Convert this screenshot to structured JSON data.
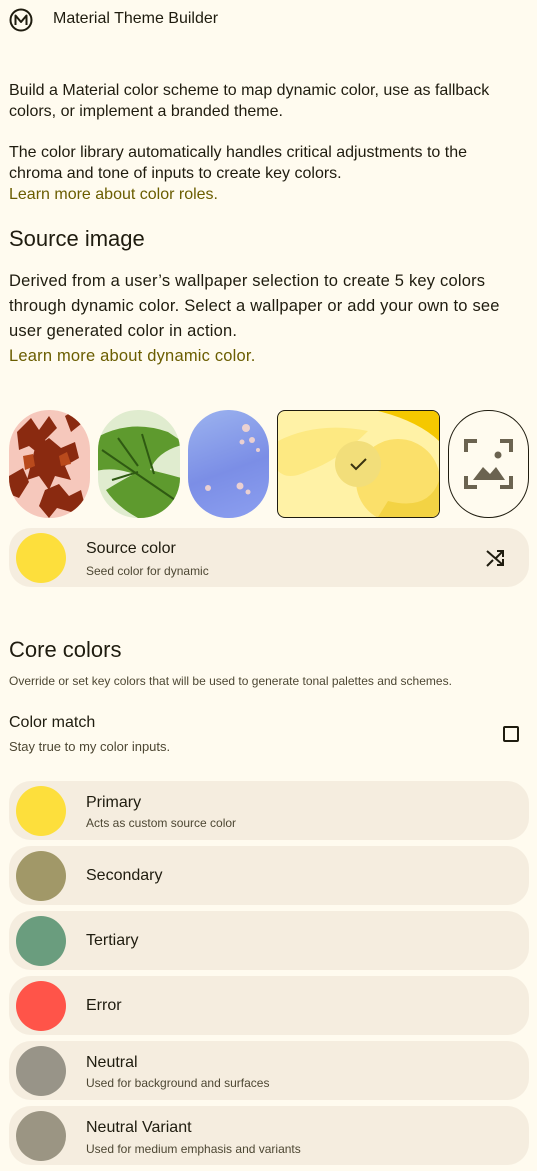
{
  "header": {
    "title": "Material Theme Builder",
    "logo_icon": "material-logo-icon"
  },
  "intro": {
    "p1": "Build a Material color scheme to map dynamic color, use as fallback colors, or implement a branded theme.",
    "p2": "The color library automatically handles critical adjustments to the chroma and tone of inputs to create key colors.",
    "link": "Learn more about color roles."
  },
  "source_image": {
    "heading": "Source image",
    "description": "Derived from a user’s wallpaper selection to create 5 key colors through dynamic color. Select a wallpaper or add your own to see user generated color in action.",
    "link": "Learn more about dynamic color.",
    "wallpapers": [
      {
        "name": "wallpaper-autumn-leaves",
        "selected": false
      },
      {
        "name": "wallpaper-green-leaf",
        "selected": false
      },
      {
        "name": "wallpaper-blue-bubbles",
        "selected": false
      },
      {
        "name": "wallpaper-yellow-abstract",
        "selected": true
      }
    ],
    "add_icon": "add-image-icon"
  },
  "source_color": {
    "label": "Source color",
    "sub": "Seed color for dynamic",
    "color": "#fddf3c",
    "action_icon": "shuffle-icon"
  },
  "core_colors": {
    "heading": "Core colors",
    "description": "Override or set key colors that will be used to generate tonal palettes and schemes.",
    "color_match": {
      "label": "Color match",
      "sub": "Stay true to my color inputs.",
      "checked": false
    },
    "items": [
      {
        "label": "Primary",
        "sub": "Acts as custom source color",
        "color": "#fddf3c"
      },
      {
        "label": "Secondary",
        "sub": "",
        "color": "#a19868"
      },
      {
        "label": "Tertiary",
        "sub": "",
        "color": "#6a9d7e"
      },
      {
        "label": "Error",
        "sub": "",
        "color": "#ff5449"
      },
      {
        "label": "Neutral",
        "sub": "Used for background and surfaces",
        "color": "#989488"
      },
      {
        "label": "Neutral Variant",
        "sub": "Used for medium emphasis and variants",
        "color": "#9b9583"
      }
    ]
  }
}
